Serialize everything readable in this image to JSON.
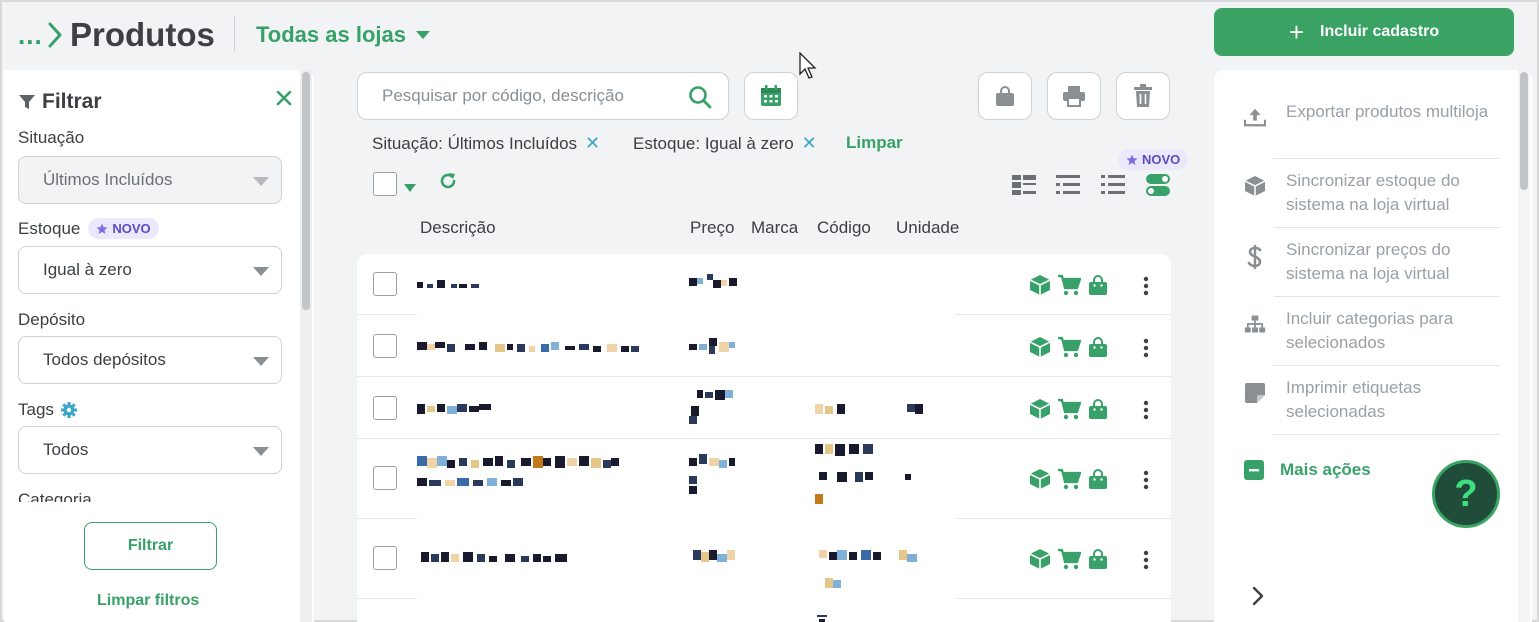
{
  "header": {
    "breadcrumb_dots": "...",
    "title": "Produtos",
    "store_select": "Todas as lojas",
    "add_button": "Incluir cadastro"
  },
  "filter": {
    "title": "Filtrar",
    "situacao_label": "Situação",
    "situacao_value": "Últimos Incluídos",
    "estoque_label": "Estoque",
    "estoque_badge": "NOVO",
    "estoque_value": "Igual à zero",
    "deposito_label": "Depósito",
    "deposito_value": "Todos depósitos",
    "tags_label": "Tags",
    "tags_value": "Todos",
    "categoria_label": "Categoria",
    "filter_button": "Filtrar",
    "clear_filters": "Limpar filtros"
  },
  "search": {
    "placeholder": "Pesquisar por código, descrição"
  },
  "chips": [
    {
      "label": "Situação: Últimos Incluídos"
    },
    {
      "label": "Estoque: Igual à zero"
    }
  ],
  "chips_clear": "Limpar",
  "view_badge": "NOVO",
  "table": {
    "columns": [
      "Descrição",
      "Preço",
      "Marca",
      "Código",
      "Unidade"
    ]
  },
  "actions": [
    {
      "label": "Exportar produtos multiloja",
      "icon": "upload-icon"
    },
    {
      "label": "Sincronizar estoque do sistema na loja virtual",
      "icon": "box-icon"
    },
    {
      "label": "Sincronizar preços do sistema na loja virtual",
      "icon": "dollar-icon"
    },
    {
      "label": "Incluir categorias para selecionados",
      "icon": "sitemap-icon"
    },
    {
      "label": "Imprimir etiquetas selecionadas",
      "icon": "sticky-note-icon"
    }
  ],
  "more_actions": "Mais ações",
  "help_label": "?",
  "colors": {
    "brand_green": "#38a169",
    "novo_purple": "#5b4bc4",
    "chip_x_blue": "#3ba6c8",
    "help_bg": "#1f4d3a"
  }
}
